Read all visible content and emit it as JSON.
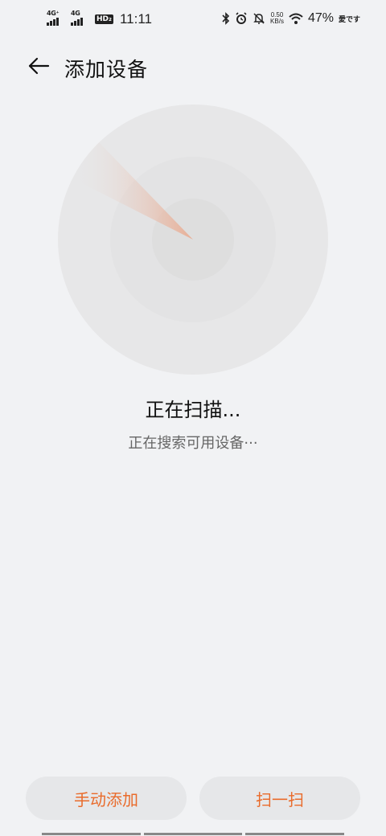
{
  "status_bar": {
    "sim1_network": "4G⁺",
    "sim2_network": "4G",
    "hd_badge": "HD₂",
    "time": "11:11",
    "speed_value": "0.50",
    "speed_unit": "KB/s",
    "battery_percent": "47%",
    "carrier": "愛です",
    "icons": [
      "bluetooth-icon",
      "alarm-icon",
      "mute-icon",
      "wifi-icon"
    ]
  },
  "header": {
    "title": "添加设备",
    "back_icon": "arrow-left-icon"
  },
  "radar": {
    "sweep_color": "#e9a98e",
    "outer_color": "#e7e7e8",
    "middle_color": "#e3e3e4",
    "inner_color": "#dedede"
  },
  "scan": {
    "title": "正在扫描...",
    "subtitle": "正在搜索可用设备···"
  },
  "buttons": {
    "manual_add": "手动添加",
    "scan_code": "扫一扫"
  },
  "colors": {
    "accent": "#e96b2b",
    "background": "#f1f2f4",
    "button_bg": "#e6e7e9"
  }
}
